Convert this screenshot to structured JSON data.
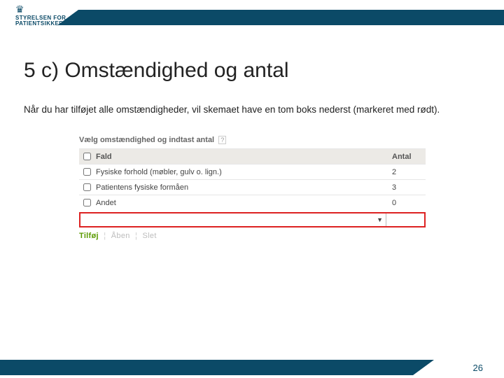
{
  "logo": {
    "line1": "STYRELSEN FOR",
    "line2": "PATIENTSIKKERHED"
  },
  "title": "5 c) Omstændighed og antal",
  "description": "Når du har tilføjet alle omstændigheder, vil skemaet have en tom boks nederst (markeret med rødt).",
  "form": {
    "heading": "Vælg omstændighed og indtast antal",
    "help": "?",
    "header_row": {
      "label": "Fald",
      "count_header": "Antal"
    },
    "rows": [
      {
        "label": "Fysiske forhold (møbler, gulv o. lign.)",
        "count": "2"
      },
      {
        "label": "Patientens fysiske formåen",
        "count": "3"
      },
      {
        "label": "Andet",
        "count": "0"
      }
    ],
    "actions": {
      "add": "Tilføj",
      "open": "Åben",
      "delete": "Slet"
    }
  },
  "page_number": "26"
}
